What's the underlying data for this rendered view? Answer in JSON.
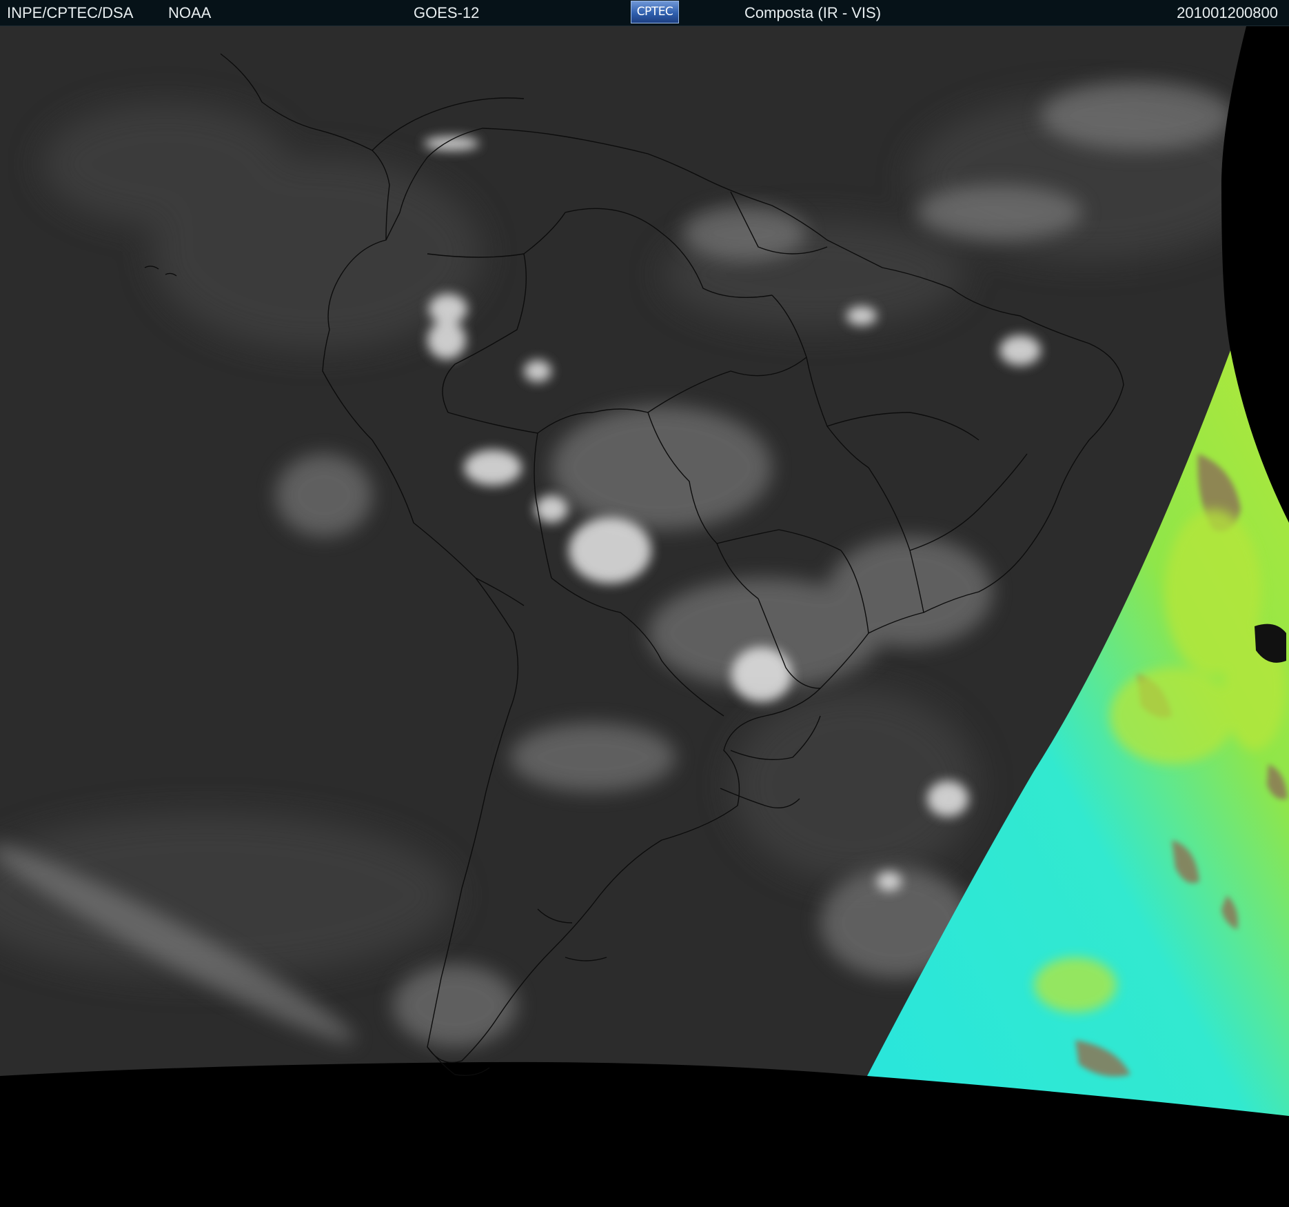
{
  "header": {
    "agency": "INPE/CPTEC/DSA",
    "partner": "NOAA",
    "satellite": "GOES-12",
    "logo_text": "CPTEC",
    "product": "Composta (IR - VIS)",
    "timestamp": "201001200800"
  },
  "colors": {
    "background": "#000000",
    "header_bar": "#061218",
    "header_text": "#e8eef0",
    "ocean_dark": "#2a2a2a",
    "cloud_white": "#e6e6e6",
    "coastline": "#0a0a0a",
    "vis_cyan": "#22e7d8",
    "vis_green": "#a7e83c",
    "vis_brown": "#8f7a52"
  },
  "icons": {
    "logo": "cptec-logo"
  }
}
